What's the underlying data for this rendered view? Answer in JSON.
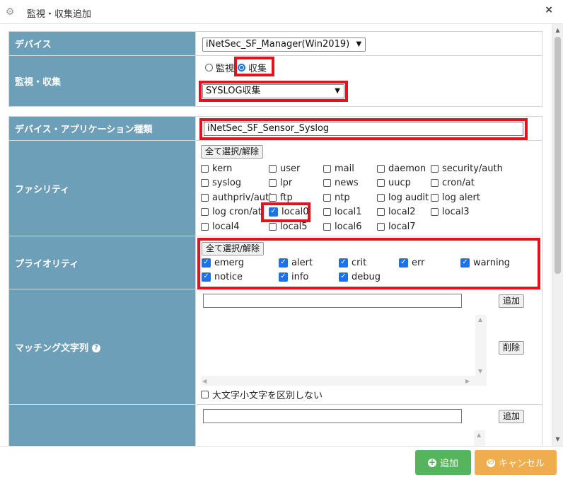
{
  "window": {
    "title": "監視・収集追加",
    "close_label": "×"
  },
  "form": {
    "device": {
      "label": "デバイス",
      "value": "iNetSec_SF_Manager(Win2019)"
    },
    "monitor_collect": {
      "label": "監視・収集",
      "radio_monitor": "監視",
      "radio_collect": "収集",
      "selected": "収集",
      "type_value": "SYSLOG収集"
    },
    "app_type": {
      "label": "デバイス・アプリケーション種類",
      "value": "iNetSec_SF_Sensor_Syslog"
    },
    "facility": {
      "label": "ファシリティ",
      "toggle_label": "全て選択/解除",
      "items": [
        {
          "label": "kern",
          "checked": false
        },
        {
          "label": "user",
          "checked": false
        },
        {
          "label": "mail",
          "checked": false
        },
        {
          "label": "daemon",
          "checked": false
        },
        {
          "label": "security/auth",
          "checked": false
        },
        {
          "label": "syslog",
          "checked": false
        },
        {
          "label": "lpr",
          "checked": false
        },
        {
          "label": "news",
          "checked": false
        },
        {
          "label": "uucp",
          "checked": false
        },
        {
          "label": "cron/at",
          "checked": false
        },
        {
          "label": "authpriv/auth",
          "checked": false
        },
        {
          "label": "ftp",
          "checked": false
        },
        {
          "label": "ntp",
          "checked": false
        },
        {
          "label": "log audit",
          "checked": false
        },
        {
          "label": "log alert",
          "checked": false
        },
        {
          "label": "log cron/at",
          "checked": false
        },
        {
          "label": "local0",
          "checked": true
        },
        {
          "label": "local1",
          "checked": false
        },
        {
          "label": "local2",
          "checked": false
        },
        {
          "label": "local3",
          "checked": false
        },
        {
          "label": "local4",
          "checked": false
        },
        {
          "label": "local5",
          "checked": false
        },
        {
          "label": "local6",
          "checked": false
        },
        {
          "label": "local7",
          "checked": false
        }
      ]
    },
    "priority": {
      "label": "プライオリティ",
      "toggle_label": "全て選択/解除",
      "items": [
        {
          "label": "emerg",
          "checked": true
        },
        {
          "label": "alert",
          "checked": true
        },
        {
          "label": "crit",
          "checked": true
        },
        {
          "label": "err",
          "checked": true
        },
        {
          "label": "warning",
          "checked": true
        },
        {
          "label": "notice",
          "checked": true
        },
        {
          "label": "info",
          "checked": true
        },
        {
          "label": "debug",
          "checked": true
        }
      ]
    },
    "matching": {
      "label": "マッチング文字列",
      "input_value": "",
      "add_label": "追加",
      "delete_label": "削除",
      "case_label": "大文字小文字を区別しない",
      "case_checked": false
    },
    "next_row": {
      "input_value": "",
      "add_label": "追加"
    }
  },
  "footer": {
    "add_label": "追加",
    "cancel_label": "キャンセル"
  },
  "colors": {
    "label_bg": "#6e9fb9",
    "highlight": "#e0141e",
    "add_btn": "#55b55c",
    "cancel_btn": "#f0ad4e",
    "check": "#1a73e8"
  }
}
